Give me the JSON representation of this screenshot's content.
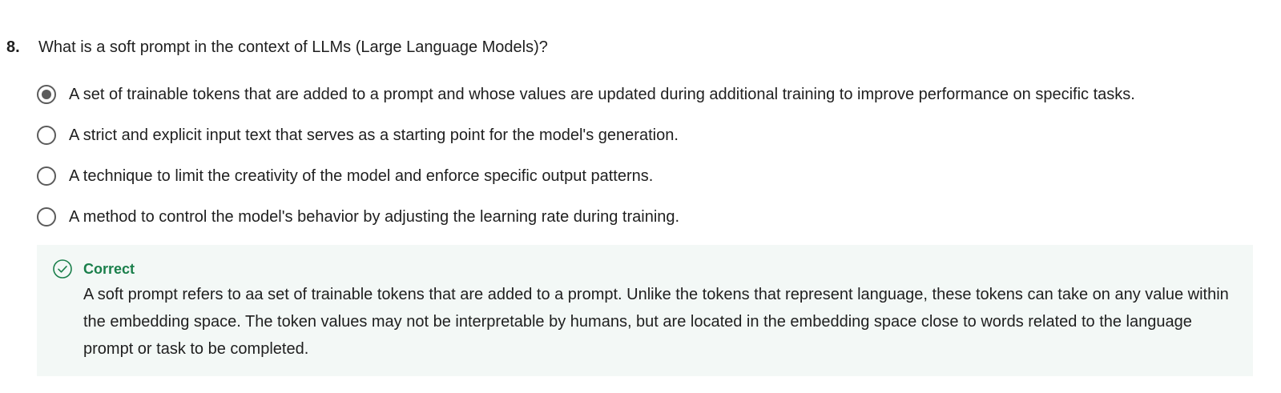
{
  "question": {
    "number": "8.",
    "text": "What is a soft prompt in the context of LLMs (Large Language Models)?"
  },
  "options": [
    {
      "label": "A set of trainable tokens that are added to a prompt and whose values are updated during additional training to improve performance on specific tasks.",
      "selected": true
    },
    {
      "label": "A strict and explicit input text that serves as a starting point for the model's generation.",
      "selected": false
    },
    {
      "label": "A technique to limit the creativity of the model and enforce specific output patterns.",
      "selected": false
    },
    {
      "label": "A method to control the model's behavior by adjusting the learning rate during training.",
      "selected": false
    }
  ],
  "feedback": {
    "status": "Correct",
    "icon": "check-circle-icon",
    "text": "A soft prompt refers to aa set of trainable tokens that are added to a prompt. Unlike the tokens that represent language, these tokens can take on any value within the embedding space. The token values may not be interpretable by humans, but are located in the embedding space close to words related to the language prompt or task to be completed.",
    "status_color": "#1a7f4b",
    "background_color": "#f3f8f6"
  }
}
